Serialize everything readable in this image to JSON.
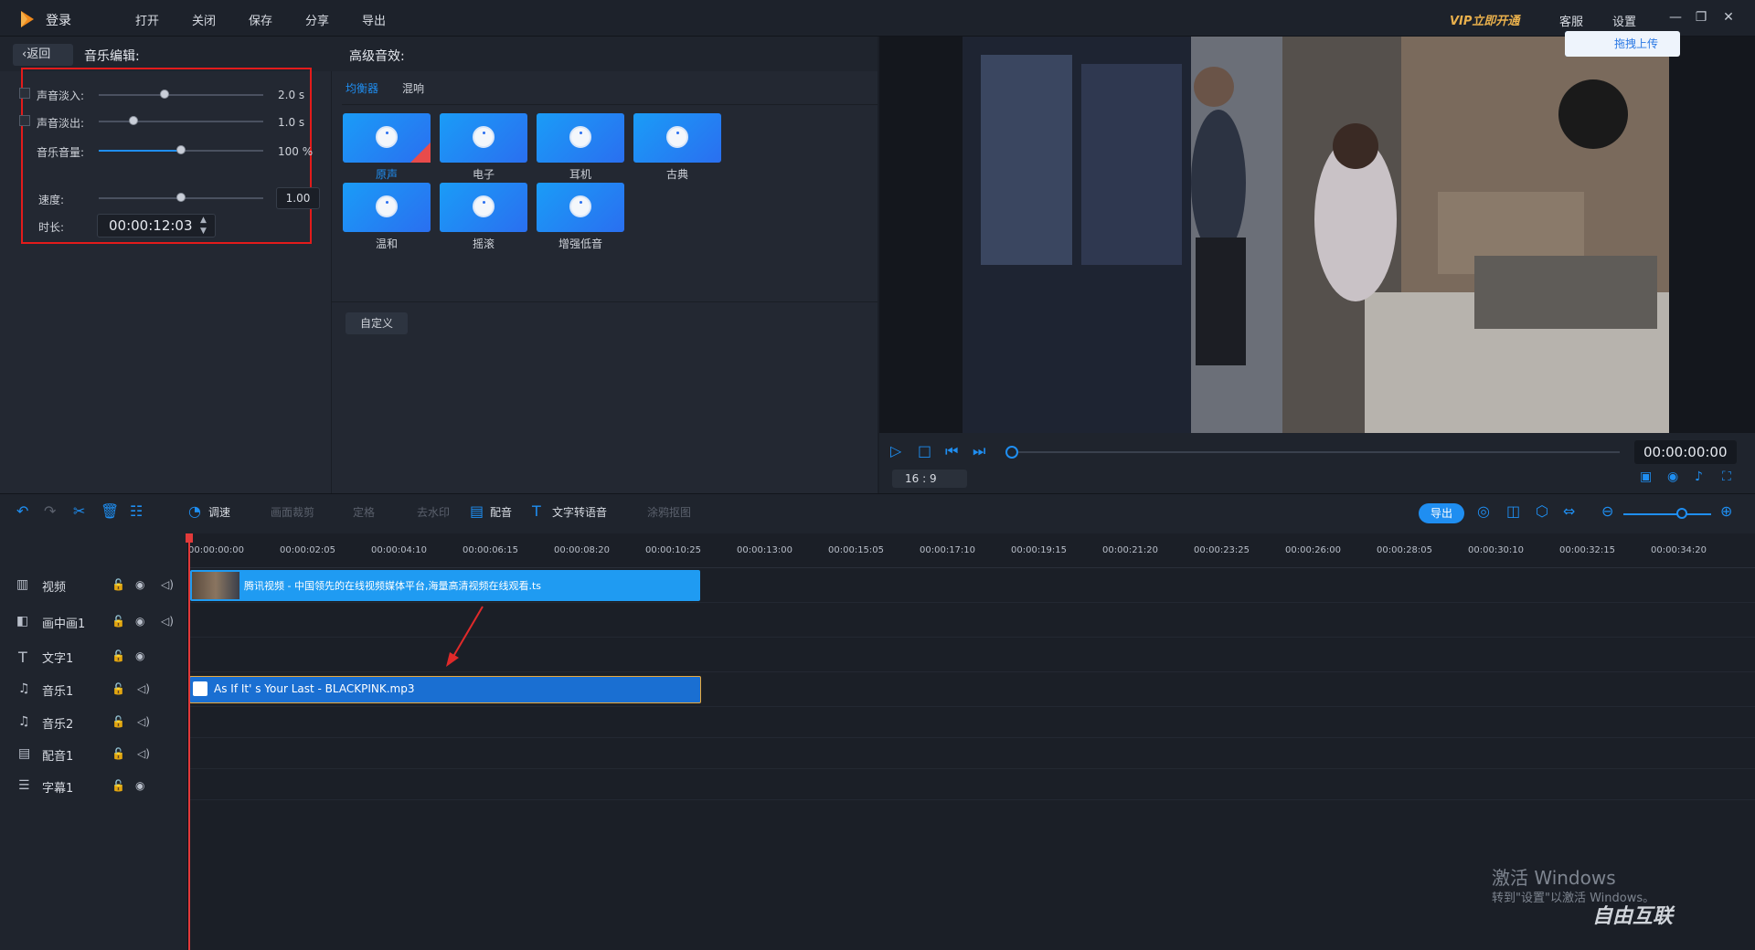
{
  "topbar": {
    "login": "登录",
    "menu": [
      "打开",
      "关闭",
      "保存",
      "分享",
      "导出"
    ],
    "vip": "VIP立即开通",
    "service": "客服",
    "settings": "设置"
  },
  "editor": {
    "back": "返回",
    "music_edit": "音乐编辑:",
    "adv_effects": "高级音效:",
    "fade_in_label": "声音淡入:",
    "fade_in_value": "2.0 s",
    "fade_in_level": 0.4,
    "fade_out_label": "声音淡出:",
    "fade_out_value": "1.0 s",
    "fade_out_level": 0.2,
    "volume_label": "音乐音量:",
    "volume_value": "100 %",
    "volume_level": 0.5,
    "speed_label": "速度:",
    "speed_value": "1.00",
    "speed_level": 0.5,
    "duration_label": "时长:",
    "duration_value": "00:00:12:03"
  },
  "effects": {
    "tabs": [
      "均衡器",
      "混响"
    ],
    "presets": [
      "原声",
      "电子",
      "耳机",
      "古典",
      "温和",
      "摇滚",
      "增强低音"
    ],
    "selected": "原声",
    "custom": "自定义"
  },
  "preview": {
    "upload": "拖拽上传",
    "timecode": "00:00:00:00",
    "ratio": "16 : 9"
  },
  "toolbar": {
    "items": [
      "调速",
      "画面裁剪",
      "定格",
      "去水印",
      "配音",
      "文字转语音",
      "涂鸦抠图"
    ],
    "export": "导出"
  },
  "timeline": {
    "ticks": [
      "00:00:00:00",
      "00:00:02:05",
      "00:00:04:10",
      "00:00:06:15",
      "00:00:08:20",
      "00:00:10:25",
      "00:00:13:00",
      "00:00:15:05",
      "00:00:17:10",
      "00:00:19:15",
      "00:00:21:20",
      "00:00:23:25",
      "00:00:26:00",
      "00:00:28:05",
      "00:00:30:10",
      "00:00:32:15",
      "00:00:34:20"
    ],
    "tracks": [
      "视频",
      "画中画1",
      "文字1",
      "音乐1",
      "音乐2",
      "配音1",
      "字幕1"
    ],
    "video_clip": "腾讯视频 - 中国领先的在线视频媒体平台,海量高清视频在线观看.ts",
    "audio_clip": "As If It' s Your Last - BLACKPINK.mp3"
  },
  "watermark": {
    "line1": "激活 Windows",
    "line2": "转到\"设置\"以激活 Windows。",
    "site": "自由互联"
  }
}
